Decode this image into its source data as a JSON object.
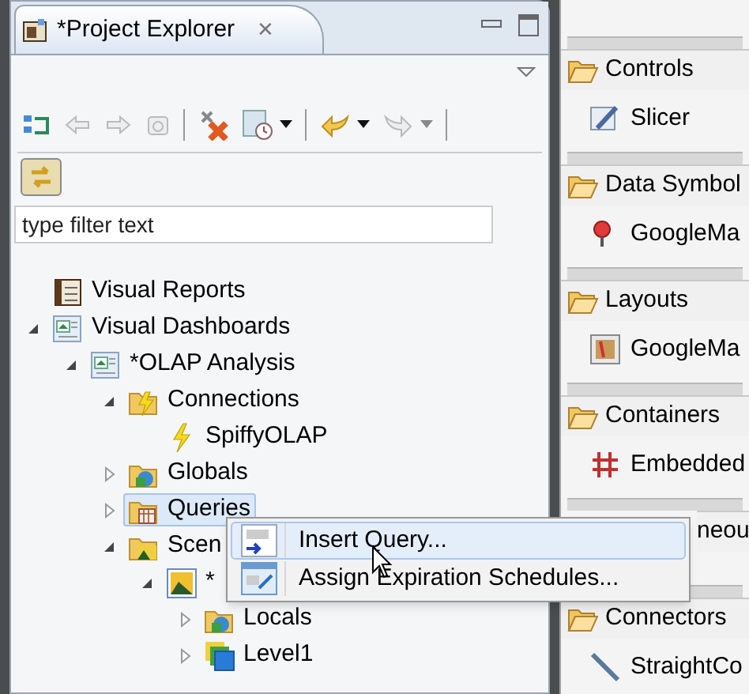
{
  "view_tab": {
    "title": "*Project Explorer",
    "close": "✕"
  },
  "filter": {
    "placeholder": "type filter text"
  },
  "link_button": {
    "selected": true
  },
  "tree": [
    {
      "label": "Visual Reports",
      "kind": "report",
      "selected": false
    },
    {
      "label": "Visual Dashboards",
      "kind": "dashboard",
      "selected": false,
      "expanded": true,
      "children": [
        {
          "label": "*OLAP Analysis",
          "kind": "dashboard",
          "selected": false,
          "expanded": true,
          "children": [
            {
              "label": "Connections",
              "kind": "connections",
              "selected": false,
              "expanded": true,
              "children": [
                {
                  "label": "SpiffyOLAP",
                  "kind": "connection",
                  "selected": false
                }
              ]
            },
            {
              "label": "Globals",
              "kind": "globals",
              "selected": false,
              "expanded": false
            },
            {
              "label": "Queries",
              "kind": "queries",
              "selected": true,
              "expanded": false
            },
            {
              "label": "Scen",
              "kind": "scenes",
              "selected": false,
              "expanded": true,
              "children": [
                {
                  "label": "*",
                  "kind": "image",
                  "selected": false,
                  "expanded": true,
                  "children": [
                    {
                      "label": "Locals",
                      "kind": "globals",
                      "selected": false,
                      "expanded": false
                    },
                    {
                      "label": "Level1",
                      "kind": "level",
                      "selected": false,
                      "expanded": false
                    }
                  ]
                }
              ]
            }
          ]
        }
      ]
    }
  ],
  "context_menu": [
    {
      "label": "Insert Query...",
      "kind": "insert",
      "selected": true
    },
    {
      "label": "Assign Expiration Schedules...",
      "kind": "schedule",
      "selected": false
    }
  ],
  "palette": [
    {
      "title": "Controls",
      "items": [
        {
          "label": "Slicer",
          "kind": "slicer"
        }
      ]
    },
    {
      "title": "Data Symbol",
      "items": [
        {
          "label": "GoogleMa",
          "kind": "pin"
        }
      ]
    },
    {
      "title": "Layouts",
      "items": [
        {
          "label": "GoogleMa",
          "kind": "map"
        }
      ]
    },
    {
      "title": "Containers",
      "items": [
        {
          "label": "Embedded",
          "kind": "embedded"
        }
      ]
    },
    {
      "title": "neou",
      "kind": "covered"
    },
    {
      "title": "Connectors",
      "items": [
        {
          "label": "StraightCo",
          "kind": "line"
        }
      ]
    }
  ]
}
